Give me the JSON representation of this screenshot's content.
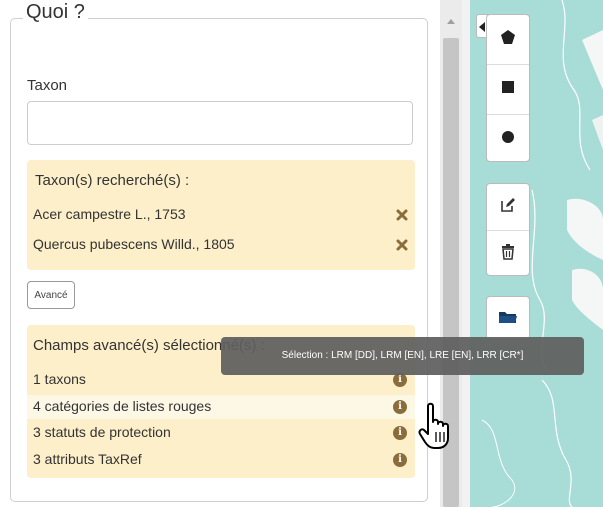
{
  "section": {
    "legend": "Quoi ?"
  },
  "taxon": {
    "label": "Taxon",
    "value": "",
    "placeholder": ""
  },
  "searched": {
    "title": "Taxon(s) recherché(s) :",
    "items": [
      {
        "label": "Acer campestre L., 1753"
      },
      {
        "label": "Quercus pubescens Willd., 1805"
      }
    ]
  },
  "advanced_button": {
    "label": "Avancé"
  },
  "advanced": {
    "title": "Champs avancé(s) sélectionné(s) :",
    "items": [
      {
        "label": "1 taxons"
      },
      {
        "label": "4 catégories de listes rouges"
      },
      {
        "label": "3 statuts de protection"
      },
      {
        "label": "3 attributs TaxRef"
      }
    ]
  },
  "tooltip": {
    "text": "Sélection : LRM [DD], LRM [EN], LRE [EN], LRR [CR*]"
  },
  "icons": {
    "remove": "remove-x-icon",
    "info": "info-icon",
    "polygon": "polygon-icon",
    "rectangle": "rectangle-icon",
    "circle": "circle-icon",
    "edit": "edit-icon",
    "trash": "trash-icon",
    "folder": "folder-icon",
    "cursor": "hand-pointer-icon"
  },
  "colors": {
    "panel_highlight": "#fcefc9",
    "remove_icon": "#8a6d3b",
    "map_water": "#a8dcd6",
    "tooltip_bg": "#5f5f5f"
  }
}
